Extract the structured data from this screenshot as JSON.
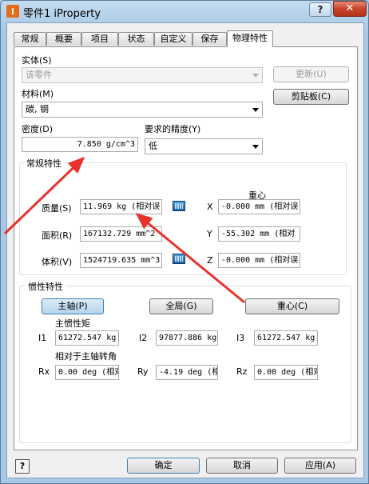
{
  "window": {
    "title": "零件1 iProperty",
    "help_glyph": "?",
    "close_glyph": "✕"
  },
  "tabs": [
    "常规",
    "概要",
    "项目",
    "状态",
    "自定义",
    "保存",
    "物理特性"
  ],
  "entity": {
    "label": "实体(S)",
    "value": "该零件"
  },
  "update_button": "更新(U)",
  "material": {
    "label": "材料(M)",
    "value": "碳, 钢"
  },
  "clipboard_button": "剪贴板(C)",
  "density": {
    "label": "密度(D)",
    "value": "7.850 g/cm^3"
  },
  "accuracy": {
    "label": "要求的精度(Y)",
    "value": "低"
  },
  "general": {
    "title": "常规特性",
    "centroid_title": "重心",
    "mass": {
      "label": "质量(S)",
      "value": "11.969 kg (相对误"
    },
    "area": {
      "label": "面积(R)",
      "value": "167132.729 mm^2"
    },
    "volume": {
      "label": "体积(V)",
      "value": "1524719.635 mm^3"
    },
    "x": {
      "label": "X",
      "value": "-0.000 mm (相对误"
    },
    "y": {
      "label": "Y",
      "value": "-55.302 mm (相对"
    },
    "z": {
      "label": "Z",
      "value": "-0.000 mm (相对误"
    }
  },
  "inertia": {
    "title": "惯性特性",
    "principal_button": "主轴(P)",
    "global_button": "全局(G)",
    "centroid_button": "重心(C)",
    "moments_title": "主惯性矩",
    "i1": {
      "label": "I1",
      "value": "61272.547 kg"
    },
    "i2": {
      "label": "I2",
      "value": "97877.886 kg"
    },
    "i3": {
      "label": "I3",
      "value": "61272.547 kg"
    },
    "rotation_title": "相对于主轴转角",
    "rx": {
      "label": "Rx",
      "value": "0.00 deg (相对"
    },
    "ry": {
      "label": "Ry",
      "value": "-4.19 deg (相"
    },
    "rz": {
      "label": "Rz",
      "value": "0.00 deg (相对"
    }
  },
  "footer": {
    "help": "?",
    "ok": "确定",
    "cancel": "取消",
    "apply": "应用(A)"
  },
  "colors": {
    "annotation_arrow": "#e8322c",
    "active_button": "#b4d5ee"
  }
}
